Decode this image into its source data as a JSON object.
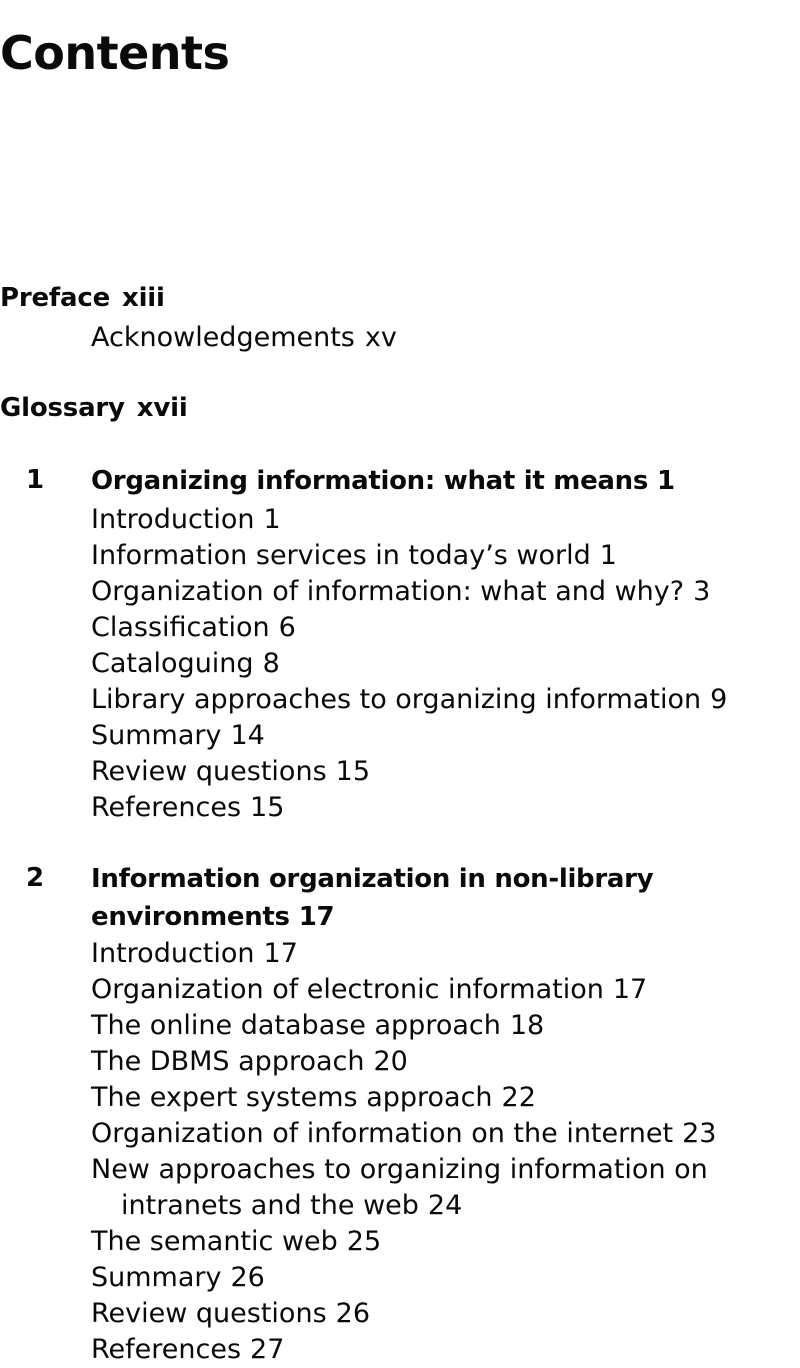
{
  "page": {
    "title": "Contents"
  },
  "front_matter": [
    {
      "label": "Preface",
      "page": "xiii",
      "style": "major"
    },
    {
      "label": "Acknowledgements",
      "page": "xv",
      "style": "minor"
    },
    {
      "label": "Glossary",
      "page": "xvii",
      "style": "major"
    }
  ],
  "chapters": [
    {
      "number": "1",
      "title": "Organizing information: what it means",
      "page": "1",
      "sections": [
        {
          "label": "Introduction",
          "page": "1"
        },
        {
          "label": "Information services in today’s world",
          "page": "1"
        },
        {
          "label": "Organization of information: what and why?",
          "page": "3"
        },
        {
          "label": "Classification",
          "page": "6"
        },
        {
          "label": "Cataloguing",
          "page": "8"
        },
        {
          "label": "Library approaches to organizing information",
          "page": "9"
        },
        {
          "label": "Summary",
          "page": "14"
        },
        {
          "label": "Review questions",
          "page": "15"
        },
        {
          "label": "References",
          "page": "15"
        }
      ]
    },
    {
      "number": "2",
      "title": "Information organization in non-library environments",
      "page": "17",
      "sections": [
        {
          "label": "Introduction",
          "page": "17"
        },
        {
          "label": "Organization of electronic information",
          "page": "17"
        },
        {
          "label": "The online database approach",
          "page": "18"
        },
        {
          "label": "The DBMS approach",
          "page": "20"
        },
        {
          "label": "The expert systems approach",
          "page": "22"
        },
        {
          "label": "Organization of information on the internet",
          "page": "23"
        },
        {
          "label": "New approaches to organizing information on intranets and the web",
          "page": "24",
          "wrap": true
        },
        {
          "label": "The semantic web",
          "page": "25"
        },
        {
          "label": "Summary",
          "page": "26"
        },
        {
          "label": "Review questions",
          "page": "26"
        },
        {
          "label": "References",
          "page": "27"
        }
      ]
    }
  ]
}
